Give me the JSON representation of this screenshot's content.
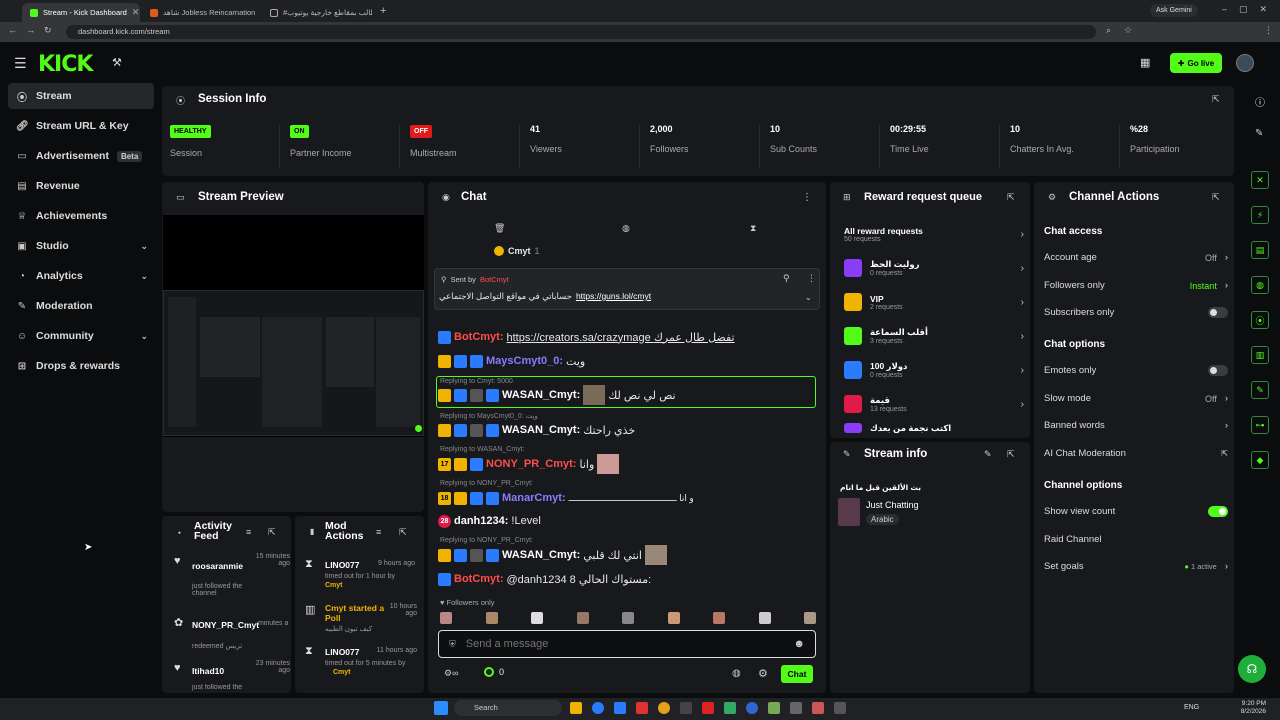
{
  "browser": {
    "tabs": [
      {
        "title": "Stream - Kick Dashboard",
        "active": true
      },
      {
        "title": "شاهد Jobless Reincarnation",
        "active": false
      },
      {
        "title": "#الطالب بمقاطع خارجية يوتيوب",
        "active": false
      }
    ],
    "url": "dashboard.kick.com/stream",
    "ask_gemini": "Ask Gemini"
  },
  "header": {
    "logo": "KICK",
    "go_live": "Go live"
  },
  "sidebar": {
    "items": [
      {
        "label": "Stream",
        "icon": "broadcast-icon",
        "active": true
      },
      {
        "label": "Stream URL & Key",
        "icon": "link-icon"
      },
      {
        "label": "Advertisement",
        "icon": "monitor-icon",
        "badge": "Beta"
      },
      {
        "label": "Revenue",
        "icon": "revenue-icon"
      },
      {
        "label": "Achievements",
        "icon": "trophy-icon"
      },
      {
        "label": "Studio",
        "icon": "studio-icon",
        "expand": true
      },
      {
        "label": "Analytics",
        "icon": "chart-icon",
        "expand": true
      },
      {
        "label": "Moderation",
        "icon": "wrench-icon"
      },
      {
        "label": "Community",
        "icon": "people-icon",
        "expand": true
      },
      {
        "label": "Drops & rewards",
        "icon": "gift-icon"
      }
    ]
  },
  "session": {
    "title": "Session Info",
    "stats": [
      {
        "value": "HEALTHY",
        "label": "Session",
        "badge_color": "#53fc18"
      },
      {
        "value": "ON",
        "label": "Partner Income",
        "badge_color": "#53fc18"
      },
      {
        "value": "OFF",
        "label": "Multistream",
        "badge_color": "#e01b1b"
      },
      {
        "value": "41",
        "label": "Viewers"
      },
      {
        "value": "2,000",
        "label": "Followers"
      },
      {
        "value": "10",
        "label": "Sub Counts"
      },
      {
        "value": "00:29:55",
        "label": "Time Live"
      },
      {
        "value": "10",
        "label": "Chatters In Avg."
      },
      {
        "value": "%28",
        "label": "Participation"
      }
    ]
  },
  "preview": {
    "title": "Stream Preview"
  },
  "activity": {
    "title": "Activity Feed",
    "items": [
      {
        "user": "roosaranmie",
        "time": "15 minutes ago",
        "action": "just followed the channel"
      },
      {
        "user": "NONY_PR_Cmyt",
        "time": "minutes ago",
        "action": "redeemed تريس"
      },
      {
        "user": "Itihad10",
        "time": "23 minutes ago",
        "action": "just followed the"
      }
    ]
  },
  "mod": {
    "title": "Mod Actions",
    "items": [
      {
        "user": "LINO077",
        "time": "9 hours ago",
        "action": "timed out for 1 hour by",
        "by": "Cmyt"
      },
      {
        "user": "Cmyt started a Poll",
        "time": "10 hours ago",
        "action": "كيف تبون الطبيه"
      },
      {
        "user": "LINO077",
        "time": "11 hours ago",
        "action": "timed out for 5 minutes by",
        "by": "Cmyt"
      }
    ]
  },
  "chat": {
    "title": "Chat",
    "top_user": "Cmyt",
    "top_count": "1",
    "pinned_by_label": "Sent by",
    "pinned_by": "BotCmyt",
    "pinned_text": "حساباتي في مواقع التواصل الاجتماعي",
    "pinned_link": "https://guns.lol/cmyt",
    "messages": [
      {
        "user": "BotCmyt:",
        "color": "#ff4d4d",
        "text": "https://creators.sa/crazymage تفضل طال عمرك",
        "link": true
      },
      {
        "user": "MaysCmyt0_0:",
        "color": "#8a7bff",
        "text": "ويت"
      },
      {
        "reply": "Replying to Cmyt: 5000",
        "user": "WASAN_Cmyt:",
        "color": "#ffffff",
        "text": "نص لي نص لك",
        "highlight": true
      },
      {
        "reply": "Replying to MaysCmyt0_0: ويت",
        "user": "WASAN_Cmyt:",
        "color": "#ffffff",
        "text": "خذي راحتك"
      },
      {
        "reply": "Replying to WASAN_Cmyt:",
        "badge": "17",
        "user": "NONY_PR_Cmyt:",
        "color": "#ff4d4d",
        "text": "وانا"
      },
      {
        "reply": "Replying to NONY_PR_Cmyt:",
        "badge": "18",
        "user": "ManarCmyt:",
        "color": "#8a7bff",
        "text": "و انا ـــــــــــــــــــــــــــــــــــــــــ"
      },
      {
        "user": "danh1234:",
        "color": "#ffffff",
        "text": "!Level",
        "badge": "28"
      },
      {
        "reply": "Replying to NONY_PR_Cmyt:",
        "user": "WASAN_Cmyt:",
        "color": "#ffffff",
        "text": "انتي لك قلبي"
      },
      {
        "user": "BotCmyt:",
        "color": "#ff4d4d",
        "text": "@danh1234 8 مستواك الحالي:"
      }
    ],
    "followers_only": "Followers only",
    "placeholder": "Send a message",
    "points": "0",
    "send": "Chat"
  },
  "reward": {
    "title": "Reward request queue",
    "all": "All reward requests",
    "all_count": "50 requests",
    "items": [
      {
        "name": "روليت الحظ",
        "count": "0 requests",
        "color": "#8b3cf7"
      },
      {
        "name": "VIP",
        "count": "2 requests",
        "color": "#f0b400"
      },
      {
        "name": "أقلب السماعة",
        "count": "3 requests",
        "color": "#53fc18"
      },
      {
        "name": "100 دولار",
        "count": "0 requests",
        "color": "#2b7bff"
      },
      {
        "name": "قيمة",
        "count": "13 requests",
        "color": "#e01b4a"
      },
      {
        "name": "اكتب نجمة من بعدك",
        "count": "",
        "color": "#8b3cf7"
      }
    ]
  },
  "streaminfo": {
    "title": "Stream info",
    "stream_title": "بث الألقين قبل ما انام",
    "category": "Just Chatting",
    "language": "Arabic"
  },
  "channel": {
    "title": "Channel Actions",
    "access_title": "Chat access",
    "account_age": "Account age",
    "account_age_val": "Off",
    "followers_only": "Followers only",
    "followers_only_val": "Instant",
    "subs_only": "Subscribers only",
    "options_title": "Chat options",
    "emotes_only": "Emotes only",
    "slow_mode": "Slow mode",
    "slow_mode_val": "Off",
    "banned_words": "Banned words",
    "ai_mod": "AI Chat Moderation",
    "chan_options_title": "Channel options",
    "show_view": "Show view count",
    "raid": "Raid Channel",
    "goals": "Set goals",
    "goals_val": "1 active"
  },
  "taskbar": {
    "search": "Search",
    "lang": "ENG",
    "time": "9:20 PM",
    "date": "8/2/2026"
  },
  "colors": {
    "brand": "#53fc18",
    "panel": "#18191c",
    "bg": "#0b0c0e"
  }
}
